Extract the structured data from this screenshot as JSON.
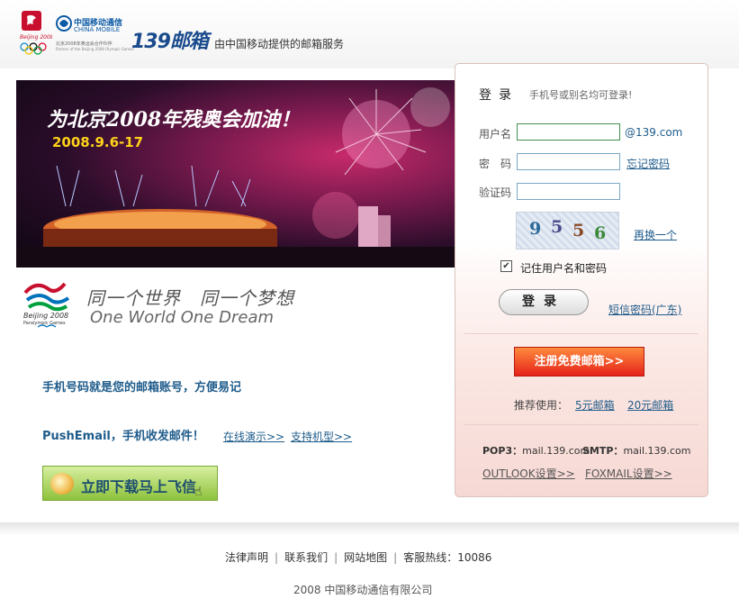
{
  "header": {
    "china_mobile_name": "中国移动通信",
    "china_mobile_en": "CHINA MOBILE",
    "partner_text": "北京2008年奥运会合作伙伴",
    "partner_text_en": "Partner of the Beijing 2008 Olympic Games",
    "brand": "139邮箱",
    "tagline": "由中国移动提供的邮箱服务"
  },
  "banner": {
    "title": "为北京2008年残奥会加油！",
    "date": "2008.9.6-17"
  },
  "slogan": {
    "cn": "同一个世界　同一个梦想",
    "en": "One World One Dream"
  },
  "promo": {
    "line1": "手机号码就是您的邮箱账号，方便易记",
    "line2": "PushEmail，手机收发邮件！",
    "demo_link": "在线演示>>",
    "models_link": "支持机型>>",
    "fetion_button": "立即下载马上飞信"
  },
  "login": {
    "title": "登录",
    "hint": "手机号或别名均可登录!",
    "username_label": "用户名",
    "username_value": "",
    "domain_suffix": "@139.com",
    "password_label": "密　码",
    "forgot_link": "忘记密码",
    "captcha_label": "验证码",
    "captcha_chars": [
      "9",
      "5",
      "5",
      "6"
    ],
    "refresh_link": "再换一个",
    "remember_checked": true,
    "remember_label": "记住用户名和密码",
    "login_button": "登录",
    "sms_link": "短信密码(广东)",
    "register_button": "注册免费邮箱>>",
    "recommend_label": "推荐使用：",
    "plan1_link": "5元邮箱",
    "plan2_link": "20元邮箱",
    "pop3_label": "POP3：",
    "pop3_value": "mail.139.com",
    "smtp_label": "SMTP：",
    "smtp_value": "mail.139.com",
    "outlook_link": "OUTLOOK设置>>",
    "foxmail_link": "FOXMAIL设置>>"
  },
  "footer": {
    "legal": "法律声明",
    "contact": "联系我们",
    "sitemap": "网站地图",
    "hotline": "客服热线：10086",
    "separator": "|",
    "copyright": "2008 中国移动通信有限公司"
  },
  "colors": {
    "link_blue": "#1f5c8b",
    "brand_blue": "#1a4b8c",
    "register_red": "#e5221a",
    "date_yellow": "#ffd21a"
  }
}
